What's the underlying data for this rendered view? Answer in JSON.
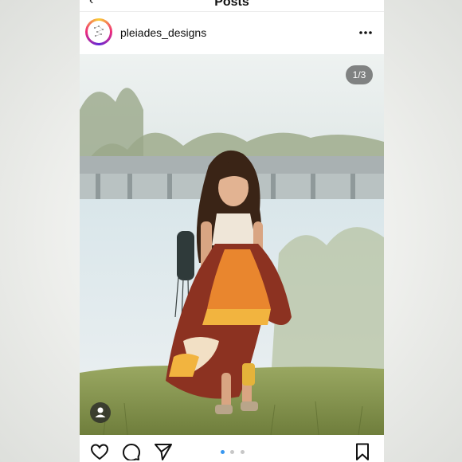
{
  "topbar": {
    "title": "Posts",
    "back_icon": "chevron-left-icon"
  },
  "post": {
    "username": "pleiades_designs",
    "avatar_icon": "constellation-logo-icon",
    "more_icon": "more-horizontal-icon"
  },
  "media": {
    "counter": "1/3",
    "tag_icon": "user-tag-icon"
  },
  "actions": {
    "like_icon": "heart-icon",
    "comment_icon": "comment-icon",
    "share_icon": "paper-plane-icon",
    "save_icon": "bookmark-icon",
    "carousel_pages": 3,
    "carousel_active": 1
  },
  "colors": {
    "accent": "#3897f0",
    "dress_rust": "#8c3221",
    "dress_orange": "#e9862e",
    "dress_gold": "#f2b43f"
  }
}
